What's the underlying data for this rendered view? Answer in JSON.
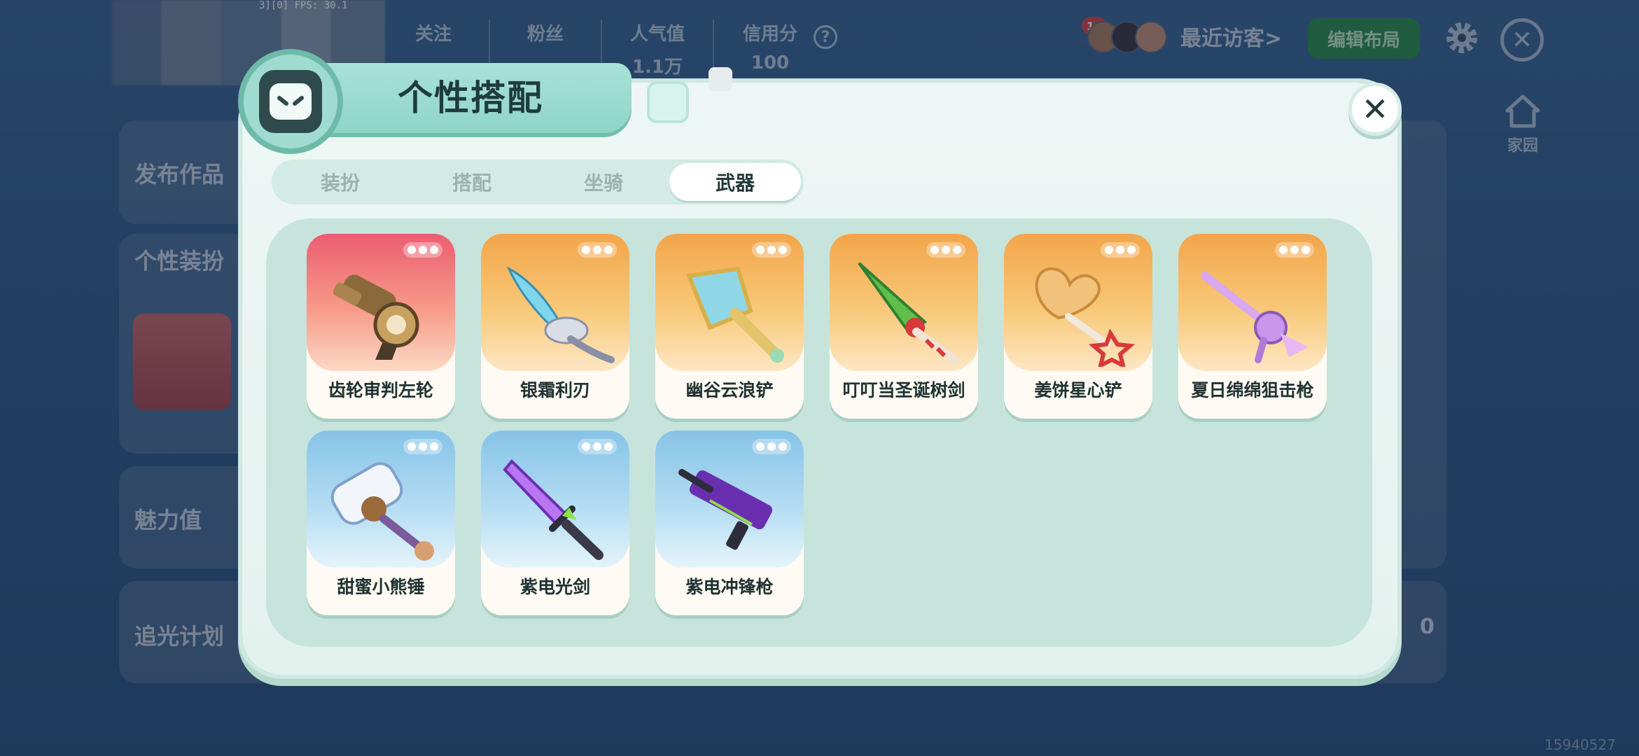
{
  "debug": "3][0] FPS: 30.1",
  "profile": {
    "stats": [
      {
        "label": "关注",
        "value": ""
      },
      {
        "label": "粉丝",
        "value": ""
      },
      {
        "label": "人气值",
        "value": "1.1万"
      },
      {
        "label": "信用分",
        "value": "100"
      }
    ],
    "visitor_count": "10",
    "recent_visitors_label": "最近访客>",
    "edit_layout_label": "编辑布局",
    "home_label": "家园"
  },
  "side_cards": [
    {
      "label": "发布作品"
    },
    {
      "label": "个性装扮"
    },
    {
      "label": "魅力值"
    },
    {
      "label": "追光计划"
    }
  ],
  "right_panel": {
    "value": "0"
  },
  "footer": {
    "id": "15940527"
  },
  "modal": {
    "title": "个性搭配",
    "tabs": [
      "装扮",
      "搭配",
      "坐骑",
      "武器"
    ],
    "active_tab": "武器",
    "items": [
      {
        "name": "齿轮审判左轮",
        "rarity": "red"
      },
      {
        "name": "银霜利刃",
        "rarity": "orange"
      },
      {
        "name": "幽谷云浪铲",
        "rarity": "orange"
      },
      {
        "name": "叮叮当圣诞树剑",
        "rarity": "orange"
      },
      {
        "name": "姜饼星心铲",
        "rarity": "orange"
      },
      {
        "name": "夏日绵绵狙击枪",
        "rarity": "orange"
      },
      {
        "name": "甜蜜小熊锤",
        "rarity": "blue"
      },
      {
        "name": "紫电光剑",
        "rarity": "blue"
      },
      {
        "name": "紫电冲锋枪",
        "rarity": "blue"
      }
    ]
  },
  "colors": {
    "modal_bg": "#edf6f4",
    "accent_mint": "#8fd5c6",
    "rarity_red": "#ec5d72",
    "rarity_orange": "#f3a54a",
    "rarity_blue": "#86c3e8",
    "edit_btn": "#2f8f4e"
  }
}
